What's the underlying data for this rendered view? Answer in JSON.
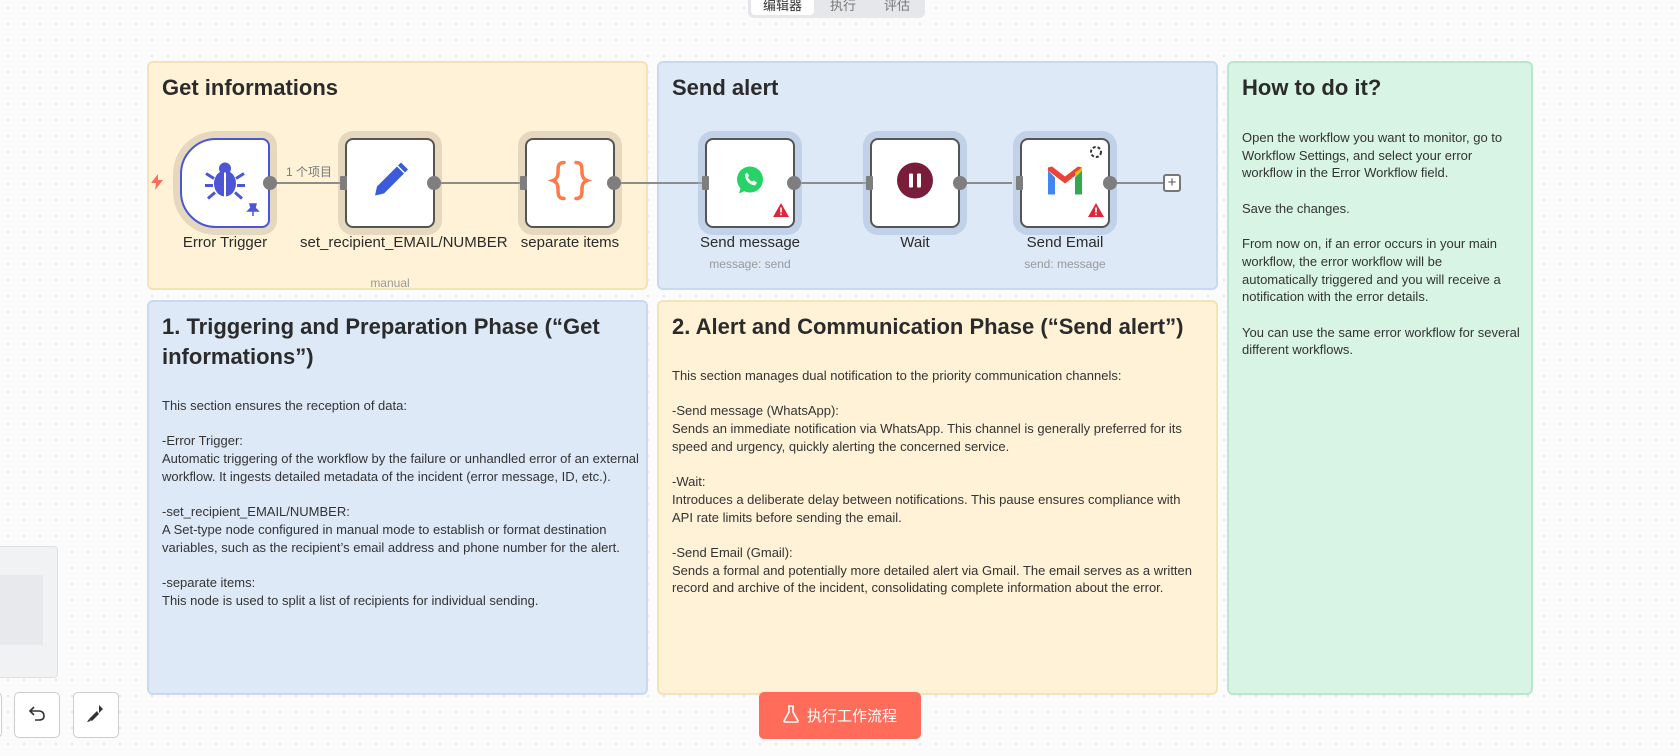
{
  "header": {
    "tabs": [
      {
        "label": "编辑器",
        "active": true
      },
      {
        "label": "执行",
        "active": false
      },
      {
        "label": "评估",
        "active": false
      }
    ]
  },
  "stickies": {
    "get_info": {
      "title": "Get informations"
    },
    "send_alert": {
      "title": "Send alert"
    },
    "how_to": {
      "title": "How to do it?",
      "body": "Open the workflow you want to monitor, go to Workflow Settings, and select your error workflow in the Error Workflow field.\n\nSave the changes.\n\nFrom now on, if an error occurs in your main workflow, the error workflow will be automatically triggered and you will receive a notification with the error details.\n\nYou can use the same error workflow for several different workflows."
    },
    "phase1": {
      "title": "1. Triggering and Preparation Phase (“Get informations”)",
      "body": "This section ensures the reception of data:\n\n-Error Trigger:\nAutomatic triggering of the workflow by the failure or unhandled error of an external workflow. It ingests detailed metadata of the incident (error message, ID, etc.).\n\n-set_recipient_EMAIL/NUMBER:\nA Set-type node configured in manual mode to establish or format destination variables, such as the recipient’s email address and phone number for the alert.\n\n-separate items:\nThis node is used to split a list of recipients for individual sending."
    },
    "phase2": {
      "title": "2. Alert and Communication Phase (“Send alert”)",
      "body": "This section manages dual notification to the priority communication channels:\n\n-Send message (WhatsApp):\nSends an immediate notification via WhatsApp. This channel is generally preferred for its speed and urgency, quickly alerting the concerned service.\n\n-Wait:\nIntroduces a deliberate delay between notifications. This pause ensures compliance with API rate limits before sending the email.\n\n-Send Email (Gmail):\nSends a formal and potentially more detailed alert via Gmail. The email serves as a written record and archive of the incident, consolidating complete information about the error."
    }
  },
  "nodes": {
    "error_trigger": {
      "label": "Error Trigger",
      "icon": "bug-icon"
    },
    "set_recipient": {
      "label": "set_recipient_EMAIL/NUMBER",
      "subtitle": "manual",
      "icon": "pencil-icon"
    },
    "separate_items": {
      "label": "separate items",
      "icon": "braces-icon"
    },
    "send_message": {
      "label": "Send message",
      "subtitle": "message: send",
      "icon": "whatsapp-icon"
    },
    "wait": {
      "label": "Wait",
      "icon": "pause-icon"
    },
    "send_email": {
      "label": "Send Email",
      "subtitle": "send: message",
      "icon": "gmail-icon"
    }
  },
  "connections": {
    "first_label": "1 个项目"
  },
  "footer": {
    "execute_label": "执行工作流程"
  },
  "colors": {
    "accent": "#ff6d5a",
    "trigger_border": "#4b55d6",
    "sticky_yellow": "#fff2d6",
    "sticky_blue": "#dde9f7",
    "sticky_green": "#d8f4e4",
    "warning": "#e0263a"
  }
}
